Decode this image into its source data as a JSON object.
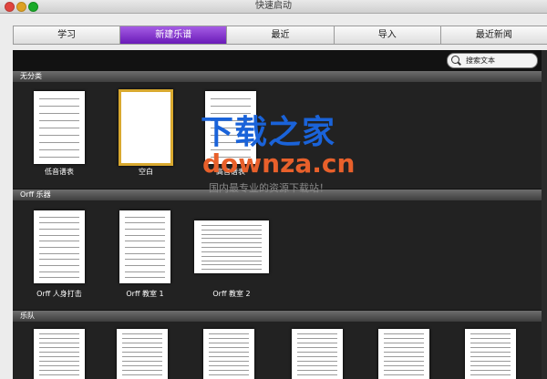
{
  "window": {
    "title": "快速启动"
  },
  "tabs": [
    {
      "label": "学习",
      "selected": false
    },
    {
      "label": "新建乐谱",
      "selected": true
    },
    {
      "label": "最近",
      "selected": false
    },
    {
      "label": "导入",
      "selected": false
    },
    {
      "label": "最近新闻",
      "selected": false
    }
  ],
  "search": {
    "placeholder": "搜索文本"
  },
  "sections": [
    {
      "name": "无分类",
      "items": [
        {
          "label": "低音谱表",
          "selected": false
        },
        {
          "label": "空白",
          "selected": true
        },
        {
          "label": "高音谱表",
          "selected": false
        }
      ]
    },
    {
      "name": "Orff 乐器",
      "items": [
        {
          "label": "Orff 人身打击",
          "selected": false
        },
        {
          "label": "Orff 教室 1",
          "selected": false
        },
        {
          "label": "Orff 教室 2",
          "selected": false
        }
      ]
    },
    {
      "name": "乐队",
      "items": []
    }
  ],
  "watermark": {
    "brand": "下载之家",
    "url": "downza.cn",
    "slogan": "国内最专业的资源下载站！"
  },
  "colors": {
    "tab_selected": "#7b2bc9",
    "selection_border": "#d9a92f",
    "background": "#121212"
  }
}
